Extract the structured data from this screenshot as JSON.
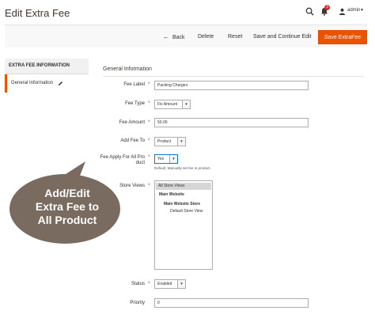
{
  "header": {
    "title": "Edit Extra Fee",
    "notifications_count": "3",
    "user_name": "admin"
  },
  "toolbar": {
    "back_label": "Back",
    "delete_label": "Delete",
    "reset_label": "Reset",
    "save_continue_label": "Save and Continue Edit",
    "save_label": "Save ExtraFee"
  },
  "sidebar": {
    "heading": "EXTRA FEE INFORMATION",
    "items": [
      {
        "label": "General Information"
      }
    ]
  },
  "form": {
    "section_title": "General Information",
    "fee_label": {
      "label": "Fee Label",
      "value": "Packing Charges"
    },
    "fee_type": {
      "label": "Fee Type",
      "value": "Fix Amount"
    },
    "fee_amount": {
      "label": "Fee Amount",
      "value": "50.00"
    },
    "add_fee_to": {
      "label": "Add Fee To",
      "value": "Product"
    },
    "fee_apply_all": {
      "label_line1": "Fee Apply For All Pro",
      "label_line2": "duct",
      "value": "Yes",
      "hint": "Default, Manually set fee in product."
    },
    "store_views": {
      "label": "Store Views",
      "options": [
        "All Store Views",
        "Main Website",
        "Main Website Store",
        "Default Store View"
      ]
    },
    "status": {
      "label": "Status",
      "value": "Enabled"
    },
    "priority": {
      "label": "Priority",
      "value": "0"
    }
  },
  "callout": {
    "line1": "Add/Edit",
    "line2": "Extra Fee to",
    "line3": "All Product"
  },
  "colors": {
    "accent": "#eb5202",
    "required": "#e22626",
    "bubble": "#7a6b61"
  }
}
